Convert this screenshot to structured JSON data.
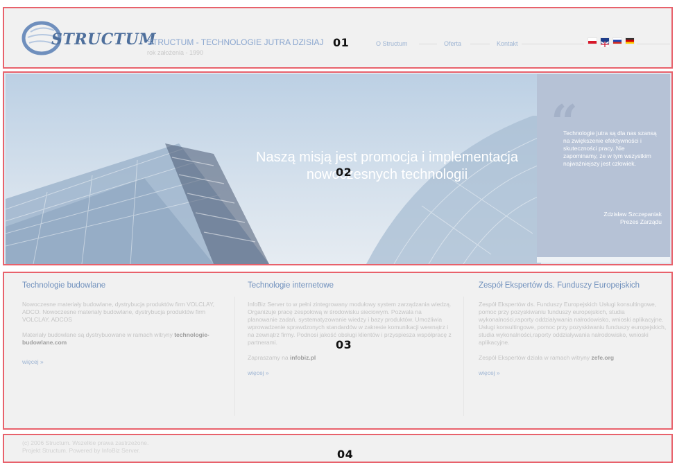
{
  "header": {
    "logo_text": "STRUCTUM",
    "title": "STRUCTUM - TECHNOLOGIE JUTRA DZISIAJ",
    "subtitle": "rok założenia - 1990",
    "nav": [
      "O Structum",
      "Oferta",
      "Kontakt"
    ],
    "flags": [
      {
        "name": "polish-flag-icon",
        "colors": [
          "#ffffff",
          "#d7182a"
        ]
      },
      {
        "name": "english-flag-icon",
        "colors": [
          "#1f3d8a",
          "#ffffff",
          "#c8102e"
        ]
      },
      {
        "name": "russian-flag-icon",
        "colors": [
          "#ffffff",
          "#1c43b0",
          "#d52b1e"
        ]
      },
      {
        "name": "german-flag-icon",
        "colors": [
          "#333333",
          "#d00000",
          "#ffce00"
        ]
      }
    ]
  },
  "banner": {
    "mission_line1": "Naszą misją jest promocja i implementacja",
    "mission_line2": "nowoczesnych technologii",
    "quote": "Technologie jutra są dla nas szansą na zwiększenie efektywności i skuteczności pracy. Nie zapominamy, że w tym wszystkim najważniejszy jest człowiek.",
    "author_name": "Zdzisław Szczepaniak",
    "author_role": "Prezes Zarządu"
  },
  "columns": [
    {
      "title": "Technologie budowlane",
      "p1": "Nowoczesne materiały budowlane, dystrybucja produktów firm VOLCLAY, ADCO. Nowoczesne materiały budowlane, dystrybucja produktów firm VOLCLAY, ADCOS",
      "p2_prefix": "Materiały budowlane są dystrybuowane w ramach witryny ",
      "p2_link": "technologie-budowlane.com",
      "more": "więcej »"
    },
    {
      "title": "Technologie internetowe",
      "p1": "InfoBiz Server to w pełni zintegrowany modułowy system zarządzania wiedzą. Organizuje pracę zespołową w środowisku sieciowym. Pozwala na planowanie zadań, systematyzowanie wiedzy i bazy produktów. Umożliwia wprowadzenie sprawdzonych standardów w zakresie komunikacji wewnątrz i na zewnątrz firmy. Podnosi jakość obsługi klientów i przyspiesza współpracę z partnerami.",
      "p2_prefix": "Zapraszamy na ",
      "p2_link": "infobiz.pl",
      "more": "więcej »"
    },
    {
      "title": "Zespół Ekspertów ds. Funduszy Europejskich",
      "p1": "Zespół Ekspertów ds. Funduszy Europejskich Usługi konsultingowe, pomoc przy pozyskiwaniu funduszy europejskich, studia wykonalności,raporty oddziaływania nałrodowisko, wnioski aplikacyjne. Usługi konsultingowe, pomoc przy pozyskiwaniu funduszy europejskich, studia wykonalności,raporty oddziaływania nałrodowisko, wnioski aplikacyjne.",
      "p2_prefix": "Zespół Ekspertów działa w ramach witryny ",
      "p2_link": "zefe.org",
      "more": "więcej »"
    }
  ],
  "footer": {
    "line1": "(c) 2006 Structum. Wszelkie prawa zastrzeżone.",
    "line2": "Projekt Structum. Powered by InfoBiz Server."
  },
  "markers": [
    "01",
    "02",
    "03",
    "04"
  ]
}
